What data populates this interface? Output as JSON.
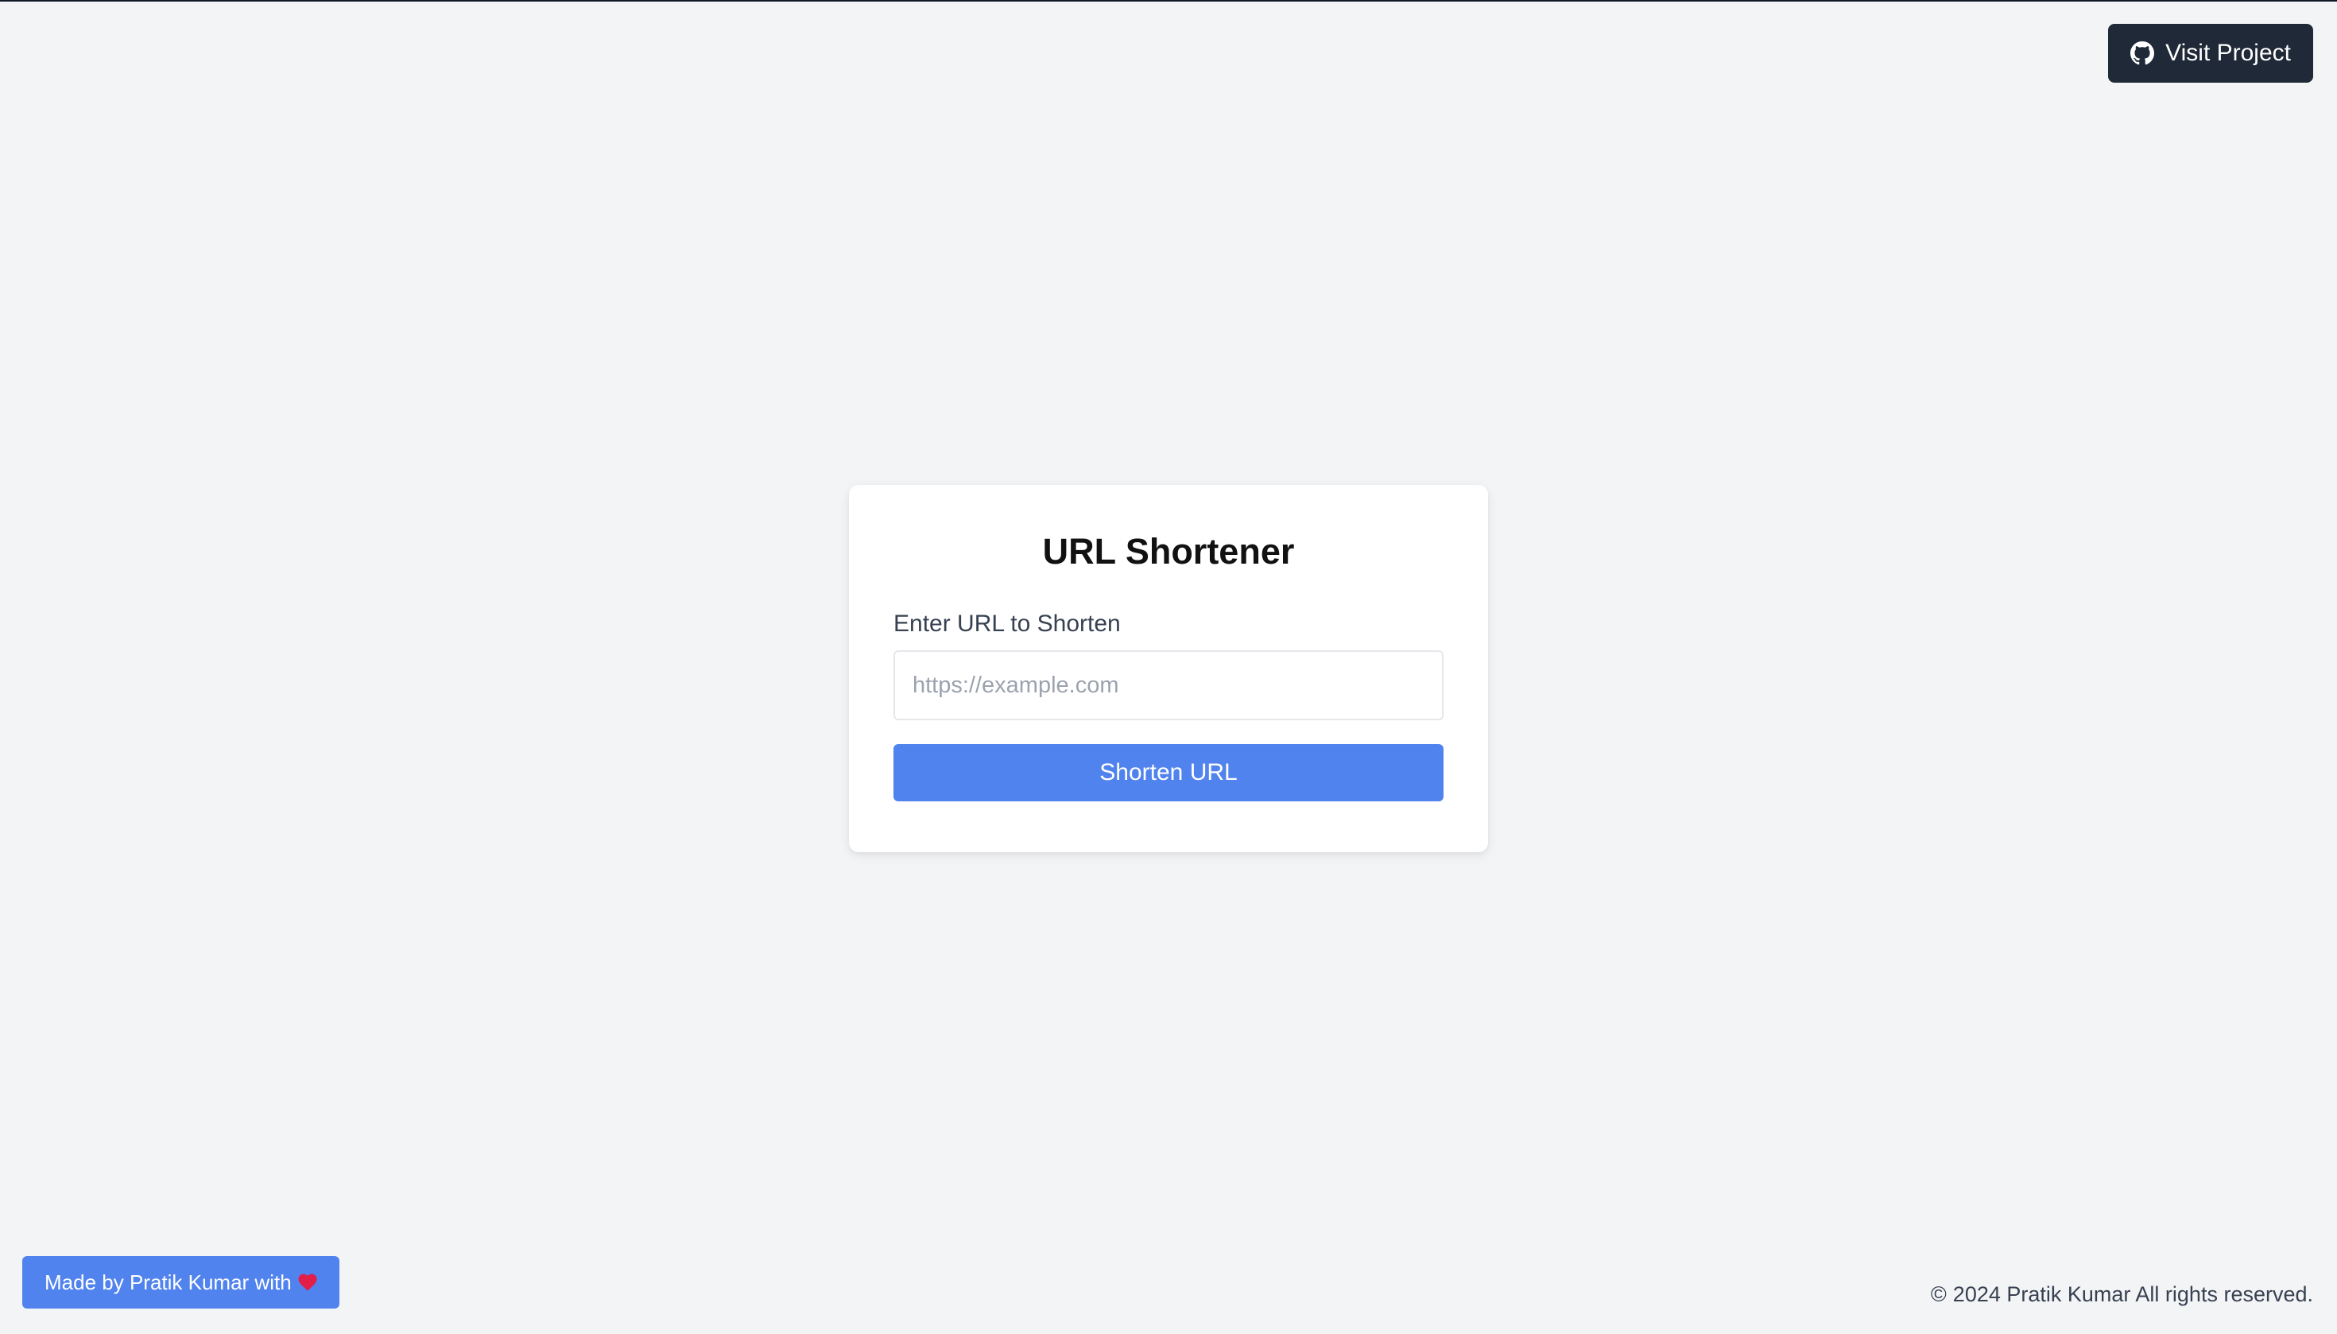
{
  "header": {
    "visit_project_label": "Visit Project",
    "icon": "github-icon"
  },
  "card": {
    "title": "URL Shortener",
    "input_label": "Enter URL to Shorten",
    "input_placeholder": "https://example.com",
    "input_value": "",
    "submit_label": "Shorten URL"
  },
  "footer": {
    "made_by_label": "Made by Pratik Kumar with",
    "made_by_icon": "heart-icon",
    "copyright_symbol": "©",
    "copyright_text": "2024 Pratik Kumar All rights reserved."
  },
  "colors": {
    "background": "#f3f4f6",
    "dark_button": "#1f2937",
    "accent_blue": "#5083ee",
    "heart": "#e11d48"
  }
}
